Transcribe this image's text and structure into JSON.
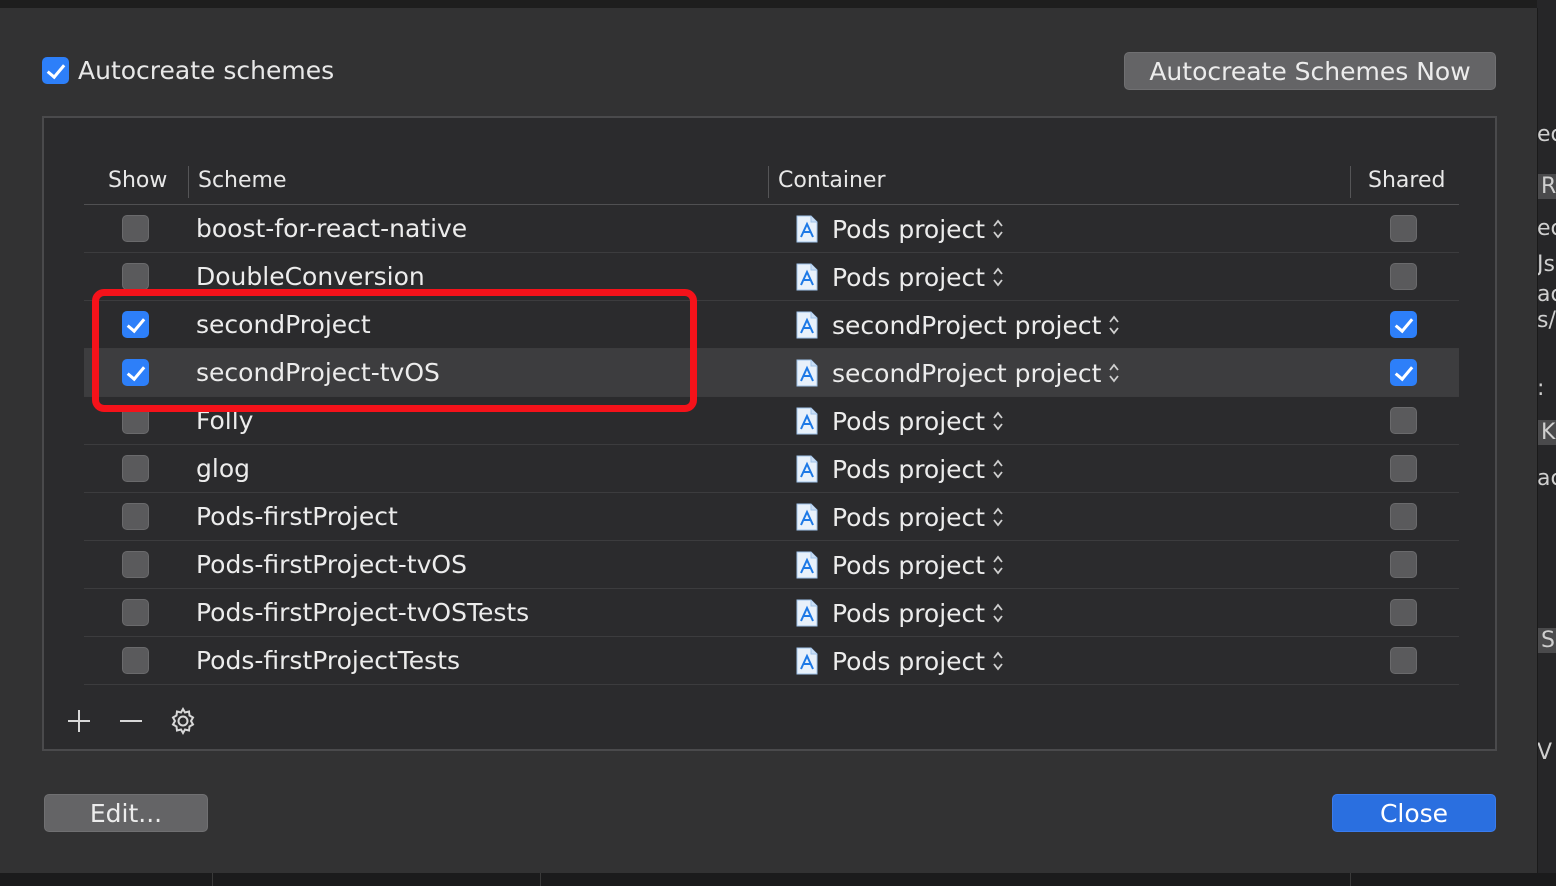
{
  "window": {
    "autocreate_label": "Autocreate schemes",
    "autocreate_checked": true,
    "autocreate_now_button": "Autocreate Schemes Now",
    "edit_button": "Edit...",
    "close_button": "Close"
  },
  "table": {
    "headers": {
      "show": "Show",
      "scheme": "Scheme",
      "container": "Container",
      "shared": "Shared"
    },
    "rows": [
      {
        "show": false,
        "scheme": "boost-for-react-native",
        "container": "Pods project",
        "shared": false
      },
      {
        "show": false,
        "scheme": "DoubleConversion",
        "container": "Pods project",
        "shared": false
      },
      {
        "show": true,
        "scheme": "secondProject",
        "container": "secondProject project",
        "shared": true
      },
      {
        "show": true,
        "scheme": "secondProject-tvOS",
        "container": "secondProject project",
        "shared": true
      },
      {
        "show": false,
        "scheme": "Folly",
        "container": "Pods project",
        "shared": false
      },
      {
        "show": false,
        "scheme": "glog",
        "container": "Pods project",
        "shared": false
      },
      {
        "show": false,
        "scheme": "Pods-firstProject",
        "container": "Pods project",
        "shared": false
      },
      {
        "show": false,
        "scheme": "Pods-firstProject-tvOS",
        "container": "Pods project",
        "shared": false
      },
      {
        "show": false,
        "scheme": "Pods-firstProject-tvOSTests",
        "container": "Pods project",
        "shared": false
      },
      {
        "show": false,
        "scheme": "Pods-firstProjectTests",
        "container": "Pods project",
        "shared": false
      }
    ]
  },
  "toolbar_icons": [
    "add-icon",
    "remove-icon",
    "gear-icon"
  ],
  "background_fragments": [
    "ec",
    "Re",
    "ec",
    "Js",
    "ac",
    "s/",
    ":",
    "Kc",
    "ac",
    "Sp",
    "V"
  ],
  "colors": {
    "accent": "#2d7ff9",
    "highlight": "#f5121a",
    "sheet": "#323233"
  }
}
